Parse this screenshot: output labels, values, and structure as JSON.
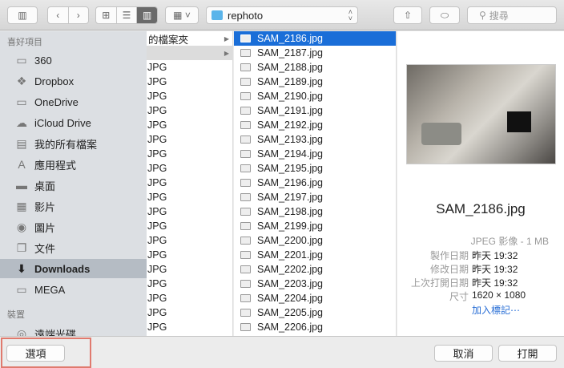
{
  "toolbar": {
    "location": "rephoto",
    "search_placeholder": "搜尋"
  },
  "sidebar": {
    "favorites_header": "喜好項目",
    "favorites": [
      {
        "label": "360",
        "icon": "folder-icon"
      },
      {
        "label": "Dropbox",
        "icon": "dropbox-icon"
      },
      {
        "label": "OneDrive",
        "icon": "folder-icon"
      },
      {
        "label": "iCloud Drive",
        "icon": "cloud-icon"
      },
      {
        "label": "我的所有檔案",
        "icon": "all-files-icon"
      },
      {
        "label": "應用程式",
        "icon": "applications-icon"
      },
      {
        "label": "桌面",
        "icon": "desktop-icon"
      },
      {
        "label": "影片",
        "icon": "movies-icon"
      },
      {
        "label": "圖片",
        "icon": "camera-icon"
      },
      {
        "label": "文件",
        "icon": "documents-icon"
      },
      {
        "label": "Downloads",
        "icon": "downloads-icon",
        "selected": true
      },
      {
        "label": "MEGA",
        "icon": "folder-icon"
      }
    ],
    "devices_header": "裝置",
    "devices": [
      {
        "label": "遠端光碟",
        "icon": "disc-icon"
      }
    ]
  },
  "column1": {
    "rows": [
      "的檔案夾",
      "",
      "JPG",
      "JPG",
      "JPG",
      "JPG",
      "JPG",
      "JPG",
      "JPG",
      "JPG",
      "JPG",
      "JPG",
      "JPG",
      "JPG",
      "JPG",
      "JPG",
      "JPG",
      "JPG",
      "JPG",
      "JPG",
      "JPG"
    ]
  },
  "column2": {
    "selected": "SAM_2186.jpg",
    "files": [
      "SAM_2186.jpg",
      "SAM_2187.jpg",
      "SAM_2188.jpg",
      "SAM_2189.jpg",
      "SAM_2190.jpg",
      "SAM_2191.jpg",
      "SAM_2192.jpg",
      "SAM_2193.jpg",
      "SAM_2194.jpg",
      "SAM_2195.jpg",
      "SAM_2196.jpg",
      "SAM_2197.jpg",
      "SAM_2198.jpg",
      "SAM_2199.jpg",
      "SAM_2200.jpg",
      "SAM_2201.jpg",
      "SAM_2202.jpg",
      "SAM_2203.jpg",
      "SAM_2204.jpg",
      "SAM_2205.jpg",
      "SAM_2206.jpg"
    ]
  },
  "preview": {
    "name": "SAM_2186.jpg",
    "kind": "JPEG 影像 - 1 MB",
    "created_label": "製作日期",
    "created": "昨天 19:32",
    "modified_label": "修改日期",
    "modified": "昨天 19:32",
    "opened_label": "上次打開日期",
    "opened": "昨天 19:32",
    "size_label": "尺寸",
    "size": "1620 × 1080",
    "add_tags": "加入標記⋯"
  },
  "footer": {
    "options": "選項",
    "cancel": "取消",
    "open": "打開"
  },
  "colors": {
    "selection": "#1a6ed8",
    "link": "#2a6fd6",
    "highlight_box": "#e07a6e"
  }
}
